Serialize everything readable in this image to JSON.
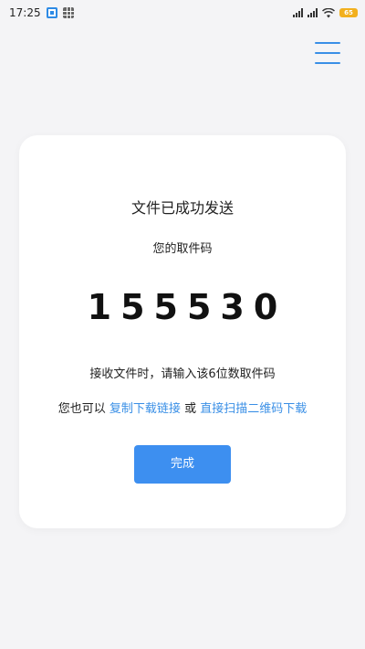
{
  "status_bar": {
    "time": "17:25",
    "battery": "65",
    "notification_icons": [
      "app-notification-icon",
      "grid-app-icon"
    ],
    "right_icons": [
      "signal-icon",
      "signal-icon",
      "wifi-icon",
      "battery-icon"
    ]
  },
  "header": {
    "menu_icon": "hamburger-menu-icon"
  },
  "card": {
    "title": "文件已成功发送",
    "code_label": "您的取件码",
    "code": "155530",
    "instruction": "接收文件时，请输入该6位数取件码",
    "alt_prefix": "您也可以",
    "copy_link_label": "复制下载链接",
    "or_text": "或",
    "scan_qr_label": "直接扫描二维码下载",
    "done_label": "完成"
  },
  "colors": {
    "accent": "#3a8fe6",
    "button": "#3d8ff0",
    "background": "#f4f4f6",
    "card": "#ffffff"
  }
}
